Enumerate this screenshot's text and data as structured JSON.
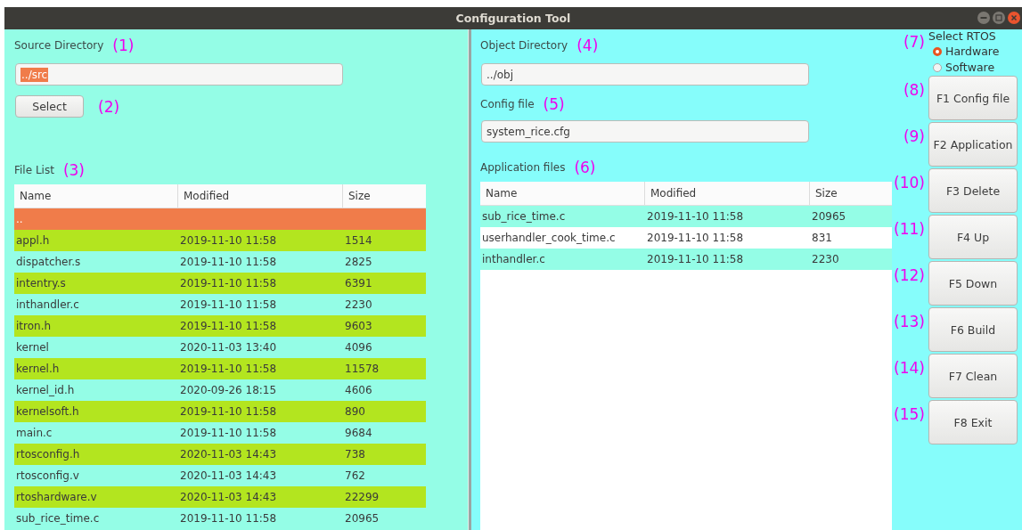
{
  "window": {
    "title": "Configuration Tool"
  },
  "source_directory": {
    "label": "Source Directory",
    "annotation": "(1)",
    "value": "../src",
    "text_selected": true,
    "button": "Select",
    "button_annotation": "(2)"
  },
  "file_list": {
    "label": "File List",
    "annotation": "(3)",
    "columns": [
      "Name",
      "Modified",
      "Size"
    ],
    "rows": [
      {
        "name": "..",
        "selected": true
      },
      {
        "name": "appl.h",
        "modified": "2019-11-10 11:58",
        "size": "1514",
        "selected": false
      },
      {
        "name": "dispatcher.s",
        "modified": "2019-11-10 11:58",
        "size": "2825",
        "selected": false
      },
      {
        "name": "intentry.s",
        "modified": "2019-11-10 11:58",
        "size": "6391",
        "selected": false
      },
      {
        "name": "inthandler.c",
        "modified": "2019-11-10 11:58",
        "size": "2230",
        "selected": false
      },
      {
        "name": "itron.h",
        "modified": "2019-11-10 11:58",
        "size": "9603",
        "selected": false
      },
      {
        "name": "kernel",
        "modified": "2020-11-03 13:40",
        "size": "4096",
        "selected": false
      },
      {
        "name": "kernel.h",
        "modified": "2019-11-10 11:58",
        "size": "11578",
        "selected": false
      },
      {
        "name": "kernel_id.h",
        "modified": "2020-09-26 18:15",
        "size": "4606",
        "selected": false
      },
      {
        "name": "kernelsoft.h",
        "modified": "2019-11-10 11:58",
        "size": "890",
        "selected": false
      },
      {
        "name": "main.c",
        "modified": "2019-11-10 11:58",
        "size": "9684",
        "selected": false
      },
      {
        "name": "rtosconfig.h",
        "modified": "2020-11-03 14:43",
        "size": "738",
        "selected": false
      },
      {
        "name": "rtosconfig.v",
        "modified": "2020-11-03 14:43",
        "size": "762",
        "selected": false
      },
      {
        "name": "rtoshardware.v",
        "modified": "2020-11-03 14:43",
        "size": "22299",
        "selected": false
      },
      {
        "name": "sub_rice_time.c",
        "modified": "2019-11-10 11:58",
        "size": "20965",
        "selected": false
      }
    ]
  },
  "object_directory": {
    "label": "Object Directory",
    "annotation": "(4)",
    "value": "../obj"
  },
  "config_file": {
    "label": "Config file",
    "annotation": "(5)",
    "value": "system_rice.cfg"
  },
  "application_files": {
    "label": "Application files",
    "annotation": "(6)",
    "columns": [
      "Name",
      "Modified",
      "Size"
    ],
    "rows": [
      {
        "name": "sub_rice_time.c",
        "modified": "2019-11-10 11:58",
        "size": "20965"
      },
      {
        "name": "userhandler_cook_time.c",
        "modified": "2019-11-10 11:58",
        "size": "831"
      },
      {
        "name": "inthandler.c",
        "modified": "2019-11-10 11:58",
        "size": "2230"
      }
    ]
  },
  "rtos": {
    "label": "Select RTOS",
    "annotation": "(7)",
    "options": [
      {
        "label": "Hardware",
        "selected": true
      },
      {
        "label": "Software",
        "selected": false
      }
    ]
  },
  "buttons": [
    {
      "label": "F1 Config file",
      "annotation": "(8)"
    },
    {
      "label": "F2 Application",
      "annotation": "(9)"
    },
    {
      "label": "F3 Delete",
      "annotation": "(10)"
    },
    {
      "label": "F4 Up",
      "annotation": "(11)"
    },
    {
      "label": "F5 Down",
      "annotation": "(12)"
    },
    {
      "label": "F6 Build",
      "annotation": "(13)"
    },
    {
      "label": "F7 Clean",
      "annotation": "(14)"
    },
    {
      "label": "F8 Exit",
      "annotation": "(15)"
    }
  ]
}
